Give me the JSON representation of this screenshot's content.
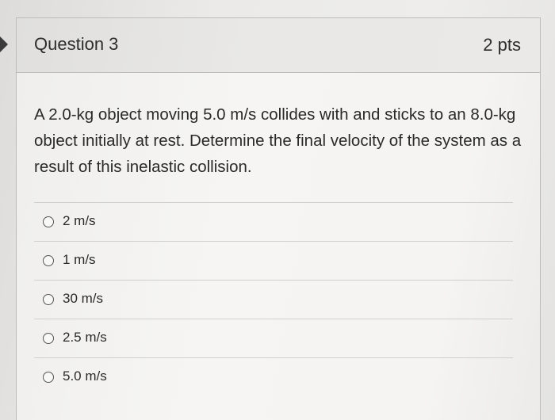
{
  "question": {
    "title": "Question 3",
    "points": "2 pts",
    "text": "A 2.0-kg object moving 5.0 m/s collides with and sticks to an 8.0-kg object initially at rest. Determine the final velocity of the system as a result of this inelastic collision."
  },
  "answers": [
    {
      "label": "2 m/s",
      "selected": false
    },
    {
      "label": "1 m/s",
      "selected": false
    },
    {
      "label": "30 m/s",
      "selected": false
    },
    {
      "label": "2.5 m/s",
      "selected": false
    },
    {
      "label": "5.0 m/s",
      "selected": false
    }
  ],
  "colors": {
    "text": "#2a2a2a",
    "header_bg": "#e9e8e6",
    "card_bg": "#f5f4f2",
    "border": "#bdbcba"
  }
}
